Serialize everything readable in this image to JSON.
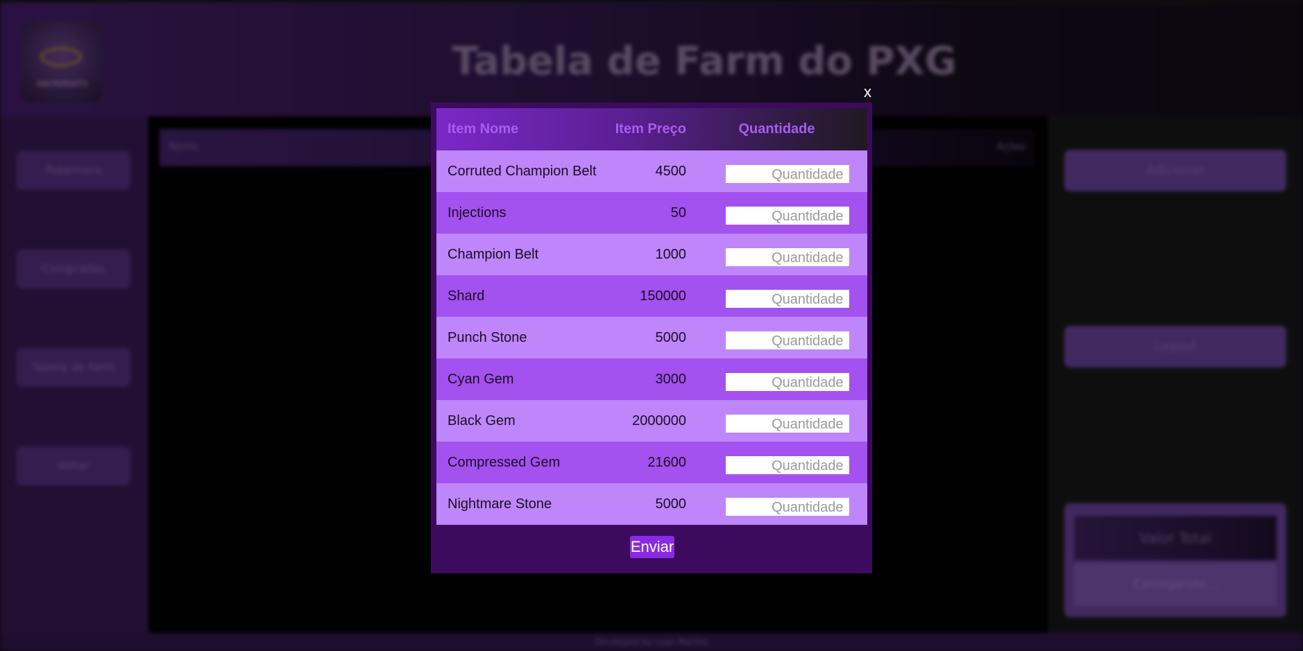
{
  "header": {
    "title": "Tabela de Farm do PXG",
    "logo_text": "ANONIMATO"
  },
  "sidebar": {
    "items": [
      {
        "label": "Pokemons"
      },
      {
        "label": "Compradas"
      },
      {
        "label": "Tabela de Farm"
      },
      {
        "label": "Voltar"
      }
    ]
  },
  "main_table": {
    "col_left": "Nome",
    "col_right": "Ações"
  },
  "rightbar": {
    "add_label": "Adicionar",
    "logout_label": "Logout",
    "total_title": "Valor Total",
    "total_value": "Carregando..."
  },
  "footer": {
    "text": "Developed by Luan Mariles"
  },
  "modal": {
    "close_label": "x",
    "headers": {
      "name": "Item Nome",
      "price": "Item Preço",
      "quantity": "Quantidade"
    },
    "rows": [
      {
        "name": "Corruted Champion Belt",
        "price": "4500",
        "placeholder": "Quantidade"
      },
      {
        "name": "Injections",
        "price": "50",
        "placeholder": "Quantidade"
      },
      {
        "name": "Champion Belt",
        "price": "1000",
        "placeholder": "Quantidade"
      },
      {
        "name": "Shard",
        "price": "150000",
        "placeholder": "Quantidade"
      },
      {
        "name": "Punch Stone",
        "price": "5000",
        "placeholder": "Quantidade"
      },
      {
        "name": "Cyan Gem",
        "price": "3000",
        "placeholder": "Quantidade"
      },
      {
        "name": "Black Gem",
        "price": "2000000",
        "placeholder": "Quantidade"
      },
      {
        "name": "Compressed Gem",
        "price": "21600",
        "placeholder": "Quantidade"
      },
      {
        "name": "Nightmare Stone",
        "price": "5000",
        "placeholder": "Quantidade"
      }
    ],
    "submit_label": "Enviar"
  },
  "colors": {
    "modal_bg": "#3d0b5e",
    "row_light": "#bf85fa",
    "row_dark": "#a351ef",
    "header_text": "#a85cf0",
    "button": "#8a2be2"
  }
}
